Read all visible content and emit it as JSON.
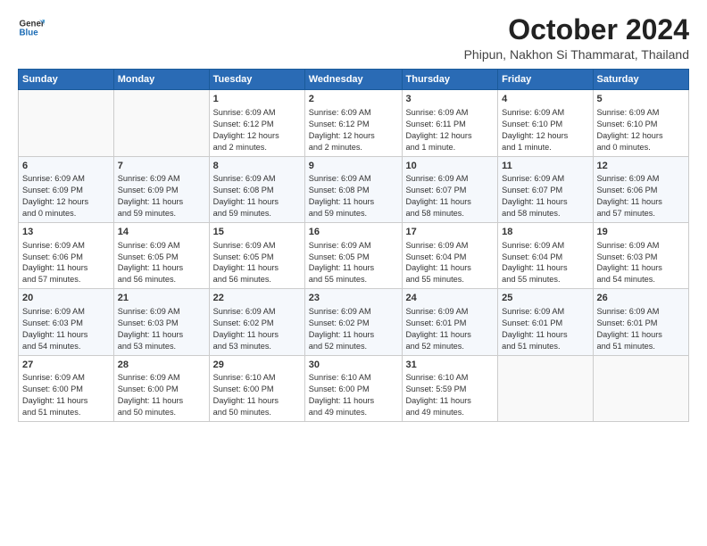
{
  "logo": {
    "general": "General",
    "blue": "Blue"
  },
  "header": {
    "month": "October 2024",
    "location": "Phipun, Nakhon Si Thammarat, Thailand"
  },
  "weekdays": [
    "Sunday",
    "Monday",
    "Tuesday",
    "Wednesday",
    "Thursday",
    "Friday",
    "Saturday"
  ],
  "weeks": [
    [
      {
        "day": "",
        "info": ""
      },
      {
        "day": "",
        "info": ""
      },
      {
        "day": "1",
        "info": "Sunrise: 6:09 AM\nSunset: 6:12 PM\nDaylight: 12 hours\nand 2 minutes."
      },
      {
        "day": "2",
        "info": "Sunrise: 6:09 AM\nSunset: 6:12 PM\nDaylight: 12 hours\nand 2 minutes."
      },
      {
        "day": "3",
        "info": "Sunrise: 6:09 AM\nSunset: 6:11 PM\nDaylight: 12 hours\nand 1 minute."
      },
      {
        "day": "4",
        "info": "Sunrise: 6:09 AM\nSunset: 6:10 PM\nDaylight: 12 hours\nand 1 minute."
      },
      {
        "day": "5",
        "info": "Sunrise: 6:09 AM\nSunset: 6:10 PM\nDaylight: 12 hours\nand 0 minutes."
      }
    ],
    [
      {
        "day": "6",
        "info": "Sunrise: 6:09 AM\nSunset: 6:09 PM\nDaylight: 12 hours\nand 0 minutes."
      },
      {
        "day": "7",
        "info": "Sunrise: 6:09 AM\nSunset: 6:09 PM\nDaylight: 11 hours\nand 59 minutes."
      },
      {
        "day": "8",
        "info": "Sunrise: 6:09 AM\nSunset: 6:08 PM\nDaylight: 11 hours\nand 59 minutes."
      },
      {
        "day": "9",
        "info": "Sunrise: 6:09 AM\nSunset: 6:08 PM\nDaylight: 11 hours\nand 59 minutes."
      },
      {
        "day": "10",
        "info": "Sunrise: 6:09 AM\nSunset: 6:07 PM\nDaylight: 11 hours\nand 58 minutes."
      },
      {
        "day": "11",
        "info": "Sunrise: 6:09 AM\nSunset: 6:07 PM\nDaylight: 11 hours\nand 58 minutes."
      },
      {
        "day": "12",
        "info": "Sunrise: 6:09 AM\nSunset: 6:06 PM\nDaylight: 11 hours\nand 57 minutes."
      }
    ],
    [
      {
        "day": "13",
        "info": "Sunrise: 6:09 AM\nSunset: 6:06 PM\nDaylight: 11 hours\nand 57 minutes."
      },
      {
        "day": "14",
        "info": "Sunrise: 6:09 AM\nSunset: 6:05 PM\nDaylight: 11 hours\nand 56 minutes."
      },
      {
        "day": "15",
        "info": "Sunrise: 6:09 AM\nSunset: 6:05 PM\nDaylight: 11 hours\nand 56 minutes."
      },
      {
        "day": "16",
        "info": "Sunrise: 6:09 AM\nSunset: 6:05 PM\nDaylight: 11 hours\nand 55 minutes."
      },
      {
        "day": "17",
        "info": "Sunrise: 6:09 AM\nSunset: 6:04 PM\nDaylight: 11 hours\nand 55 minutes."
      },
      {
        "day": "18",
        "info": "Sunrise: 6:09 AM\nSunset: 6:04 PM\nDaylight: 11 hours\nand 55 minutes."
      },
      {
        "day": "19",
        "info": "Sunrise: 6:09 AM\nSunset: 6:03 PM\nDaylight: 11 hours\nand 54 minutes."
      }
    ],
    [
      {
        "day": "20",
        "info": "Sunrise: 6:09 AM\nSunset: 6:03 PM\nDaylight: 11 hours\nand 54 minutes."
      },
      {
        "day": "21",
        "info": "Sunrise: 6:09 AM\nSunset: 6:03 PM\nDaylight: 11 hours\nand 53 minutes."
      },
      {
        "day": "22",
        "info": "Sunrise: 6:09 AM\nSunset: 6:02 PM\nDaylight: 11 hours\nand 53 minutes."
      },
      {
        "day": "23",
        "info": "Sunrise: 6:09 AM\nSunset: 6:02 PM\nDaylight: 11 hours\nand 52 minutes."
      },
      {
        "day": "24",
        "info": "Sunrise: 6:09 AM\nSunset: 6:01 PM\nDaylight: 11 hours\nand 52 minutes."
      },
      {
        "day": "25",
        "info": "Sunrise: 6:09 AM\nSunset: 6:01 PM\nDaylight: 11 hours\nand 51 minutes."
      },
      {
        "day": "26",
        "info": "Sunrise: 6:09 AM\nSunset: 6:01 PM\nDaylight: 11 hours\nand 51 minutes."
      }
    ],
    [
      {
        "day": "27",
        "info": "Sunrise: 6:09 AM\nSunset: 6:00 PM\nDaylight: 11 hours\nand 51 minutes."
      },
      {
        "day": "28",
        "info": "Sunrise: 6:09 AM\nSunset: 6:00 PM\nDaylight: 11 hours\nand 50 minutes."
      },
      {
        "day": "29",
        "info": "Sunrise: 6:10 AM\nSunset: 6:00 PM\nDaylight: 11 hours\nand 50 minutes."
      },
      {
        "day": "30",
        "info": "Sunrise: 6:10 AM\nSunset: 6:00 PM\nDaylight: 11 hours\nand 49 minutes."
      },
      {
        "day": "31",
        "info": "Sunrise: 6:10 AM\nSunset: 5:59 PM\nDaylight: 11 hours\nand 49 minutes."
      },
      {
        "day": "",
        "info": ""
      },
      {
        "day": "",
        "info": ""
      }
    ]
  ]
}
